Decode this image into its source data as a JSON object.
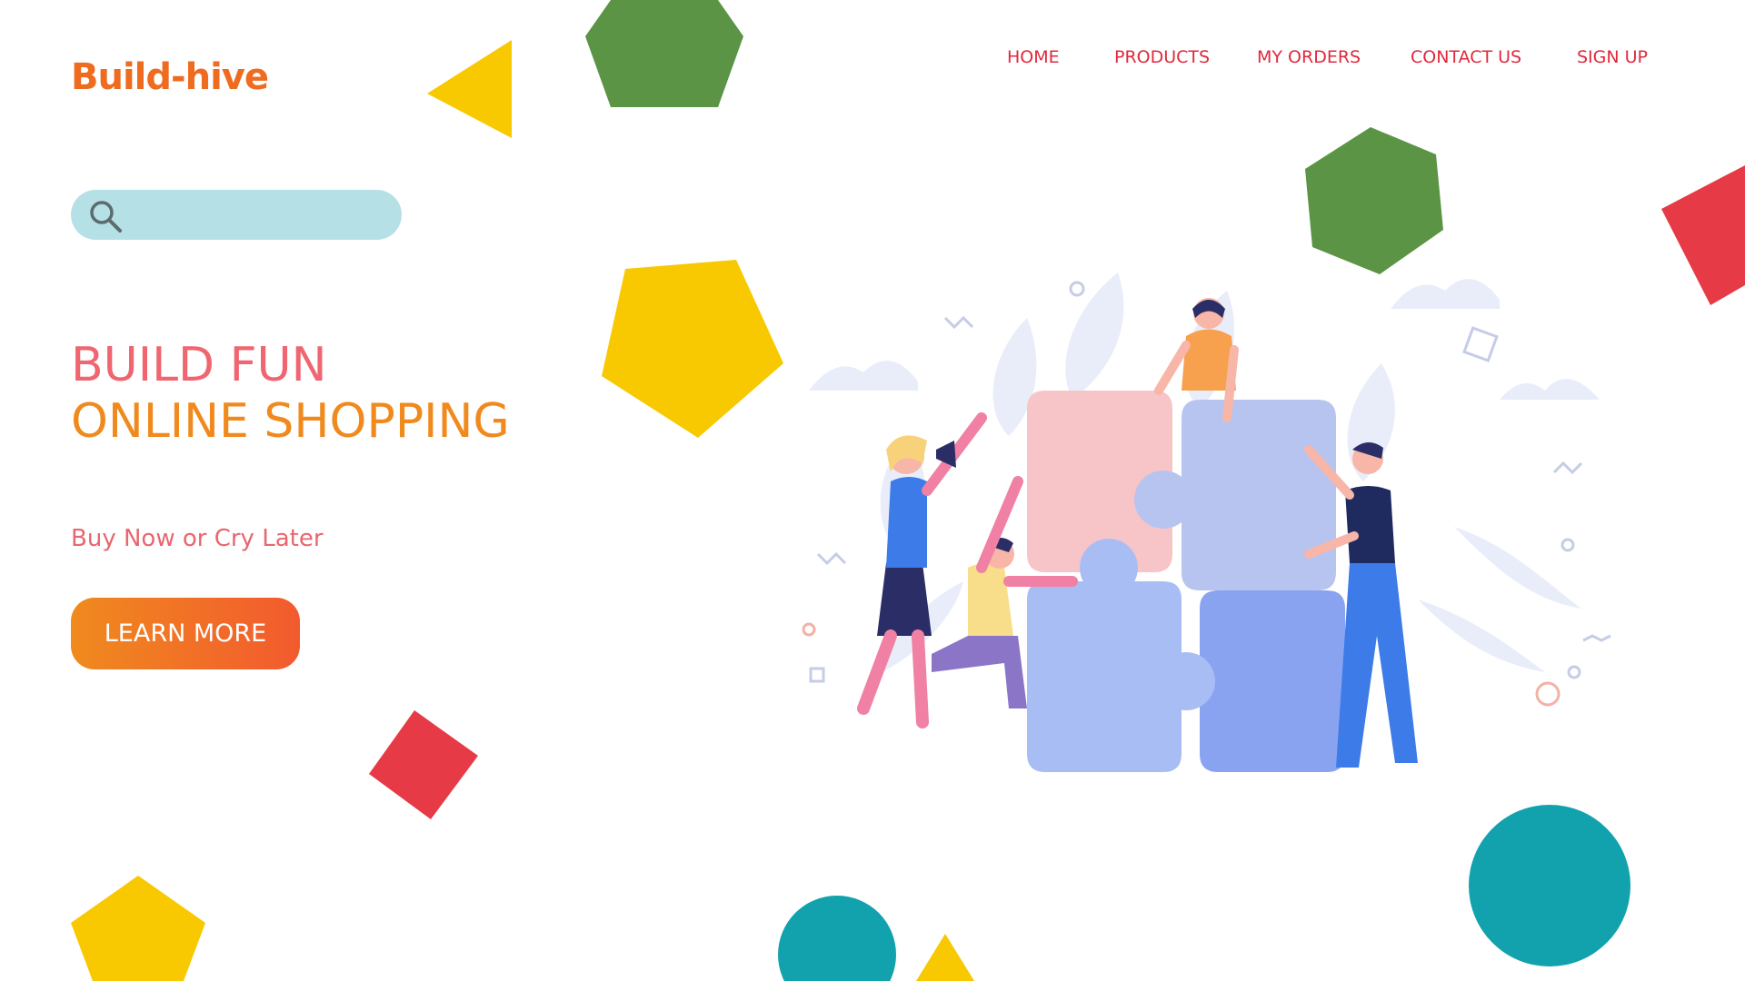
{
  "brand": {
    "logo_text": "Build-hive"
  },
  "nav": {
    "home": "HOME",
    "products": "PRODUCTS",
    "my_orders": "MY ORDERS",
    "contact_us": "CONTACT US",
    "sign_up": "SIGN UP"
  },
  "search": {
    "placeholder": "",
    "value": "",
    "icon": "search-icon"
  },
  "hero": {
    "headline_line1": "BUILD FUN",
    "headline_line2": "ONLINE SHOPPING",
    "tagline": "Buy Now or Cry Later",
    "cta_label": "LEARN MORE",
    "illustration": "team-assembling-puzzle-illustration"
  },
  "colors": {
    "nav_text": "#e0293d",
    "logo": "#ee6b1f",
    "headline_line1": "#ef6570",
    "headline_line2": "#f08a1e",
    "tagline": "#e9666f",
    "cta_gradient_start": "#f08a1e",
    "cta_gradient_end": "#f25a2e",
    "search_bg": "#b5e0e5",
    "shape_green": "#5a9444",
    "shape_yellow": "#f8c800",
    "shape_red": "#e63b47",
    "shape_teal": "#12a2ad"
  }
}
